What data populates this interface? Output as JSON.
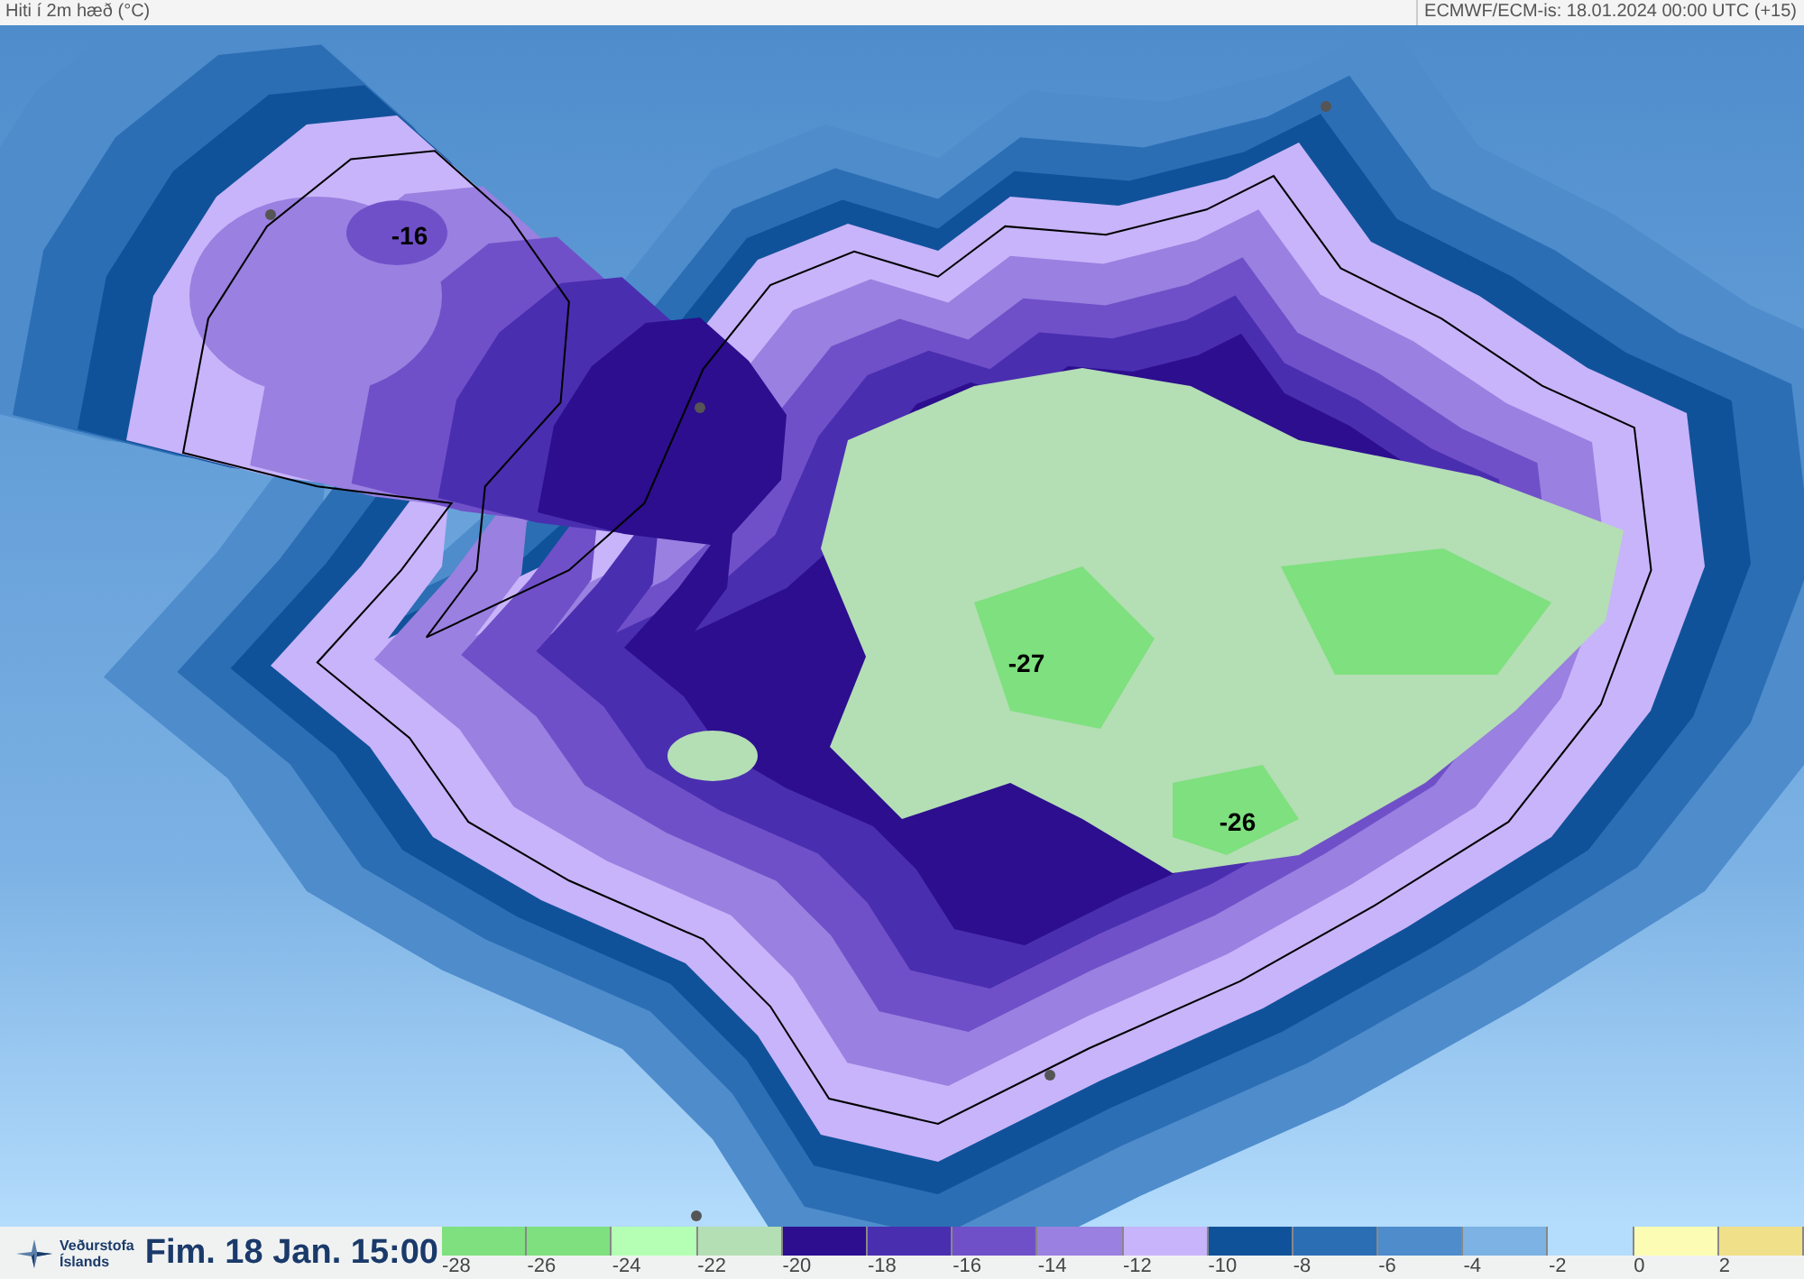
{
  "header": {
    "title": "Hiti í 2m hæð (°C)",
    "model_run": "ECMWF/ECM-is: 18.01.2024 00:00 UTC (+15)"
  },
  "map": {
    "labels": [
      "-16",
      "-27",
      "-26"
    ]
  },
  "footer": {
    "logo_text": [
      "Veðurstofa",
      "Íslands"
    ],
    "valid_time": "Fim. 18 Jan. 15:00"
  },
  "legend": [
    {
      "label": "-28",
      "color": "#7ee07e"
    },
    {
      "label": "-26",
      "color": "#7ee07e"
    },
    {
      "label": "-24",
      "color": "#b4ffb4"
    },
    {
      "label": "-22",
      "color": "#b4deb4"
    },
    {
      "label": "-20",
      "color": "#2c0e8e"
    },
    {
      "label": "-18",
      "color": "#4a2eb0"
    },
    {
      "label": "-16",
      "color": "#7050c8"
    },
    {
      "label": "-14",
      "color": "#9a80e0"
    },
    {
      "label": "-12",
      "color": "#c8b4fa"
    },
    {
      "label": "-10",
      "color": "#10529a"
    },
    {
      "label": "-8",
      "color": "#2c6eb4"
    },
    {
      "label": "-6",
      "color": "#4e8ccc"
    },
    {
      "label": "-4",
      "color": "#7cb2e4"
    },
    {
      "label": "-2",
      "color": "#b4dcfc"
    },
    {
      "label": "0",
      "color": "#fcfcb4"
    },
    {
      "label": "2",
      "color": "#f0e08a"
    }
  ]
}
